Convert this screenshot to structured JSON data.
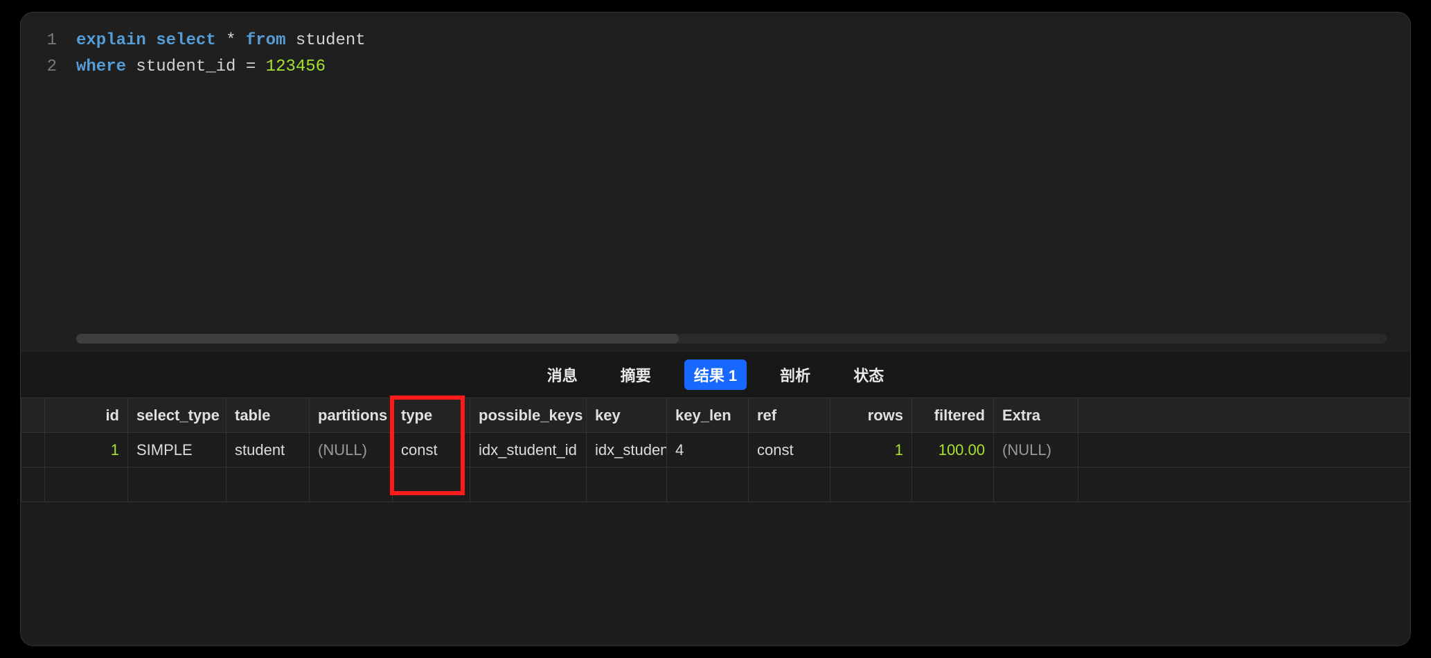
{
  "editor": {
    "lines": [
      {
        "n": "1",
        "tokens": [
          {
            "t": "explain",
            "c": "kw"
          },
          {
            "t": " ",
            "c": ""
          },
          {
            "t": "select",
            "c": "kw2"
          },
          {
            "t": " ",
            "c": ""
          },
          {
            "t": "*",
            "c": "star"
          },
          {
            "t": " ",
            "c": ""
          },
          {
            "t": "from",
            "c": "kw2"
          },
          {
            "t": " ",
            "c": ""
          },
          {
            "t": "student",
            "c": "ident"
          }
        ]
      },
      {
        "n": "2",
        "tokens": [
          {
            "t": "where",
            "c": "kw2"
          },
          {
            "t": " ",
            "c": ""
          },
          {
            "t": "student_id",
            "c": "ident"
          },
          {
            "t": " ",
            "c": ""
          },
          {
            "t": "=",
            "c": "op"
          },
          {
            "t": " ",
            "c": ""
          },
          {
            "t": "123456",
            "c": "num"
          }
        ]
      }
    ]
  },
  "tabs": {
    "items": [
      {
        "label": "消息",
        "active": false
      },
      {
        "label": "摘要",
        "active": false
      },
      {
        "label": "结果 1",
        "active": true
      },
      {
        "label": "剖析",
        "active": false
      },
      {
        "label": "状态",
        "active": false
      }
    ]
  },
  "grid": {
    "headers": [
      "id",
      "select_type",
      "table",
      "partitions",
      "type",
      "possible_keys",
      "key",
      "key_len",
      "ref",
      "rows",
      "filtered",
      "Extra"
    ],
    "rows": [
      {
        "id": "1",
        "select_type": "SIMPLE",
        "table": "student",
        "partitions": "(NULL)",
        "type": "const",
        "possible_keys": "idx_student_id",
        "key": "idx_student_id",
        "key_len": "4",
        "ref": "const",
        "rows": "1",
        "filtered": "100.00",
        "Extra": "(NULL)"
      }
    ],
    "highlight_column": "type"
  }
}
